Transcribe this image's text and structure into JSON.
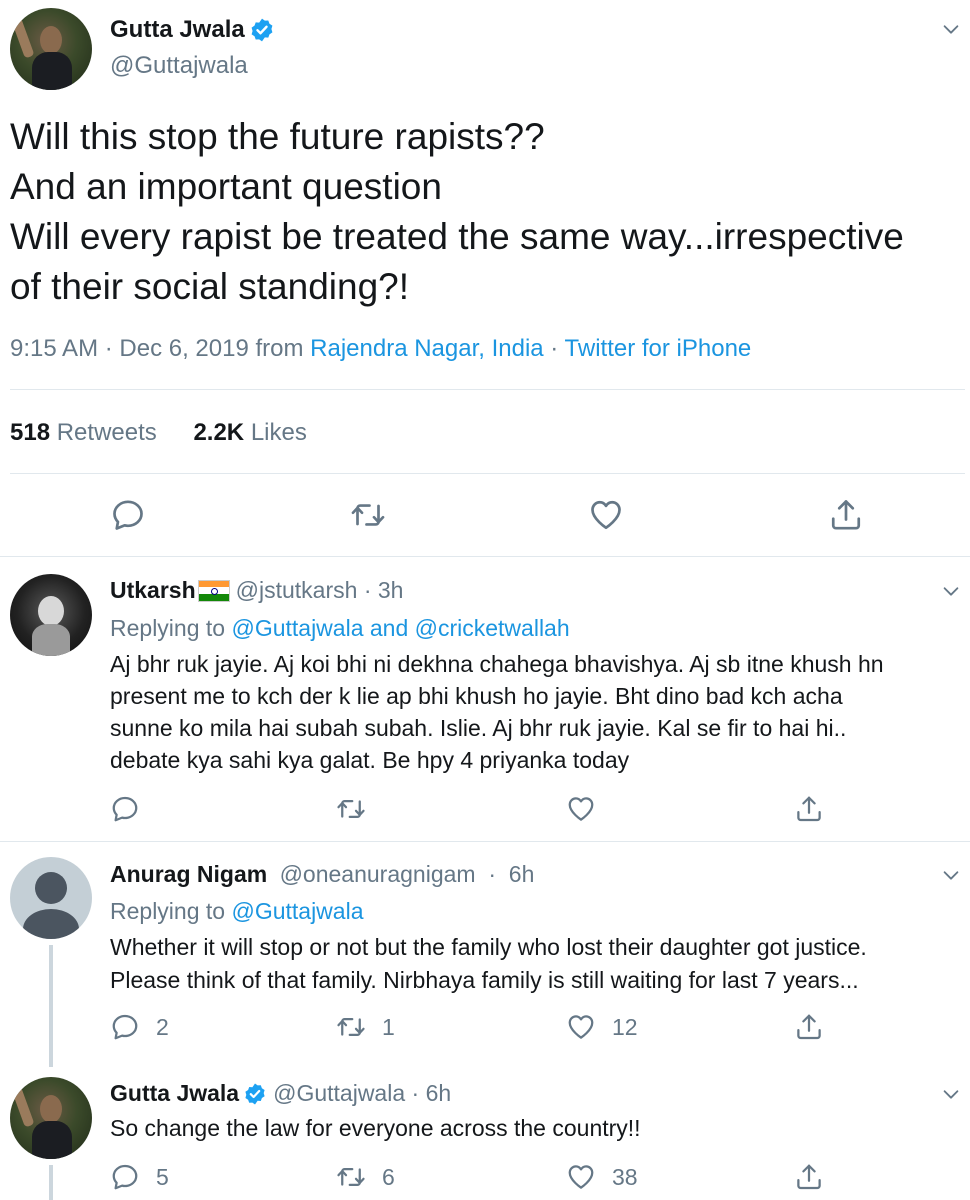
{
  "main_tweet": {
    "author_name": "Gutta Jwala",
    "author_handle": "@Guttajwala",
    "text_lines": [
      "Will this stop the future rapists??",
      "And an important question",
      "Will every rapist be treated the same way...irrespective",
      "of their social standing?!"
    ],
    "time": "9:15 AM · Dec 6, 2019 from ",
    "location": "Rajendra Nagar, India",
    "sep": " · ",
    "source": "Twitter for iPhone",
    "retweets_count": "518",
    "retweets_label": "Retweets",
    "likes_count": "2.2K",
    "likes_label": "Likes"
  },
  "replies": [
    {
      "author_name": "Utkarsh",
      "author_flag": "india-flag-icon",
      "author_handle": "@jstutkarsh",
      "time": "3h",
      "replying_label": "Replying to",
      "replying_to": "@Guttajwala and @cricketwallah",
      "text_lines": [
        "Aj bhr ruk jayie. Aj koi bhi ni dekhna chahega bhavishya. Aj sb itne khush hn",
        "present me to kch der k lie ap bhi khush ho jayie. Bht dino bad kch acha",
        "sunne ko mila hai subah subah. Islie. Aj bhr ruk jayie. Kal se fir to hai hi..",
        "debate kya sahi kya galat. Be hpy 4 priyanka today"
      ],
      "reply_count": "",
      "retweet_count": "",
      "like_count": ""
    },
    {
      "author_name": "Anurag Nigam",
      "author_handle": "@oneanuragnigam",
      "time": "6h",
      "replying_label": "Replying to",
      "replying_to": "@Guttajwala",
      "text_lines": [
        "Whether it will stop or not but the family who lost their daughter got justice.",
        "Please think of that family. Nirbhaya family is still waiting for last 7 years..."
      ],
      "reply_count": "2",
      "retweet_count": "1",
      "like_count": "12"
    },
    {
      "author_name": "Gutta Jwala",
      "author_handle": "@Guttajwala",
      "time": "6h",
      "text_lines": [
        "So change the law for everyone across the country!!"
      ],
      "reply_count": "5",
      "retweet_count": "6",
      "like_count": "38"
    }
  ],
  "colors": {
    "link": "#1b95e0",
    "muted": "#657786",
    "divider": "#e1e8ed",
    "verified": "#1da1f2"
  },
  "icons": [
    "verified-badge-icon",
    "chevron-down-icon",
    "reply-icon",
    "retweet-icon",
    "like-icon",
    "share-icon",
    "india-flag-icon"
  ]
}
